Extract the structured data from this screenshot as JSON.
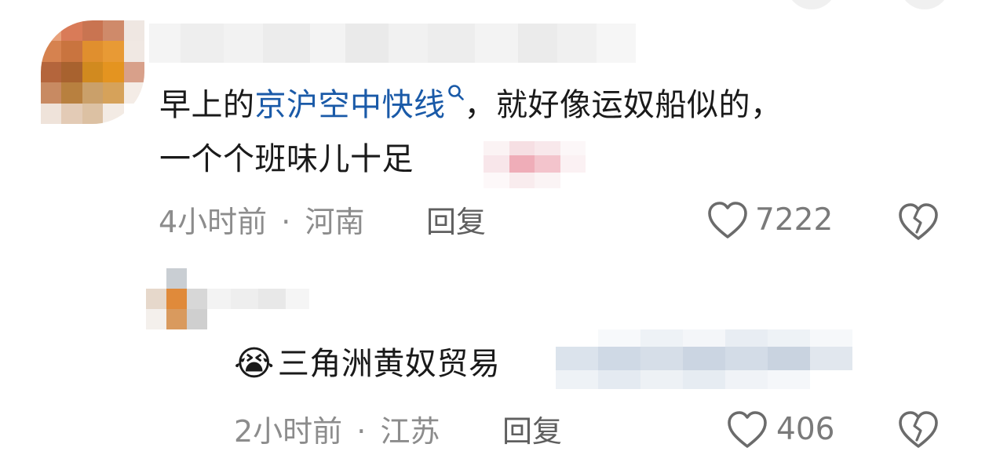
{
  "comments": [
    {
      "text_before_link": "早上的",
      "link_text": "京沪空中快线",
      "text_after_link": "，就好像运奴船似的，",
      "text_line2": "一个个班味儿十足",
      "time": "4小时前",
      "location": "河南",
      "reply_label": "回复",
      "likes": "7222"
    },
    {
      "emoji": "😭",
      "text": "三角洲黄奴贸易",
      "time": "2小时前",
      "location": "江苏",
      "reply_label": "回复",
      "likes": "406"
    }
  ],
  "separator": "·",
  "icons": {
    "search_hint": "search-icon",
    "like": "heart-icon",
    "dislike": "broken-heart-icon"
  },
  "colors": {
    "link": "#1a5aa8",
    "meta": "#8c8c8c",
    "text": "#1a1a1a"
  }
}
